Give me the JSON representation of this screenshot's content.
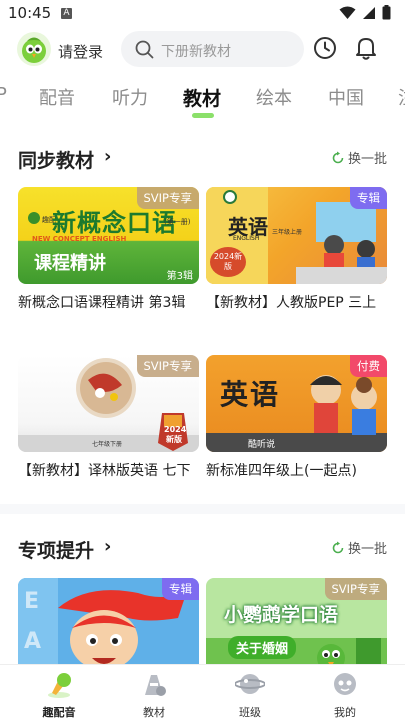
{
  "status": {
    "time": "10:45",
    "indicator": "A"
  },
  "header": {
    "login": "请登录",
    "search_placeholder": "下册新教材"
  },
  "tabs": [
    "P",
    "配音",
    "听力",
    "教材",
    "绘本",
    "中国",
    "注"
  ],
  "sections": [
    {
      "title": "同步教材",
      "refresh": "换一批",
      "cards": [
        {
          "badge": "SVIP专享",
          "title": "新概念口语课程精讲 第3辑",
          "cover": {
            "main": "新概念口语",
            "sub": "课程精讲",
            "tag": "(第一册)",
            "en": "NEW CONCEPT ENGLISH",
            "vol": "第3辑"
          }
        },
        {
          "badge": "专辑",
          "title": "【新教材】人教版PEP 三上",
          "cover": {
            "main": "英语",
            "sub": "ENGLISH",
            "year": "2024新版",
            "grade": "三年级上册"
          }
        },
        {
          "badge": "SVIP专享",
          "title": "【新教材】译林版英语 七下",
          "cover": {
            "year": "2024",
            "grade": "七年级下册",
            "new": "新版"
          }
        },
        {
          "badge": "付费",
          "title": "新标准四年级上(一起点)",
          "cover": {
            "main": "英语",
            "brand": "酷听说"
          }
        }
      ]
    },
    {
      "title": "专项提升",
      "refresh": "换一批",
      "cards": [
        {
          "badge": "专辑",
          "title": ""
        },
        {
          "badge": "SVIP专享",
          "title": "",
          "cover": {
            "main": "小鹦鹉学口语",
            "sub": "关于婚姻"
          }
        }
      ]
    }
  ],
  "bottom_nav": [
    {
      "label": "趣配音",
      "icon": "dubbing-icon",
      "active": true
    },
    {
      "label": "教材",
      "icon": "textbook-icon",
      "active": false
    },
    {
      "label": "班级",
      "icon": "class-icon",
      "active": false
    },
    {
      "label": "我的",
      "icon": "profile-icon",
      "active": false
    }
  ]
}
